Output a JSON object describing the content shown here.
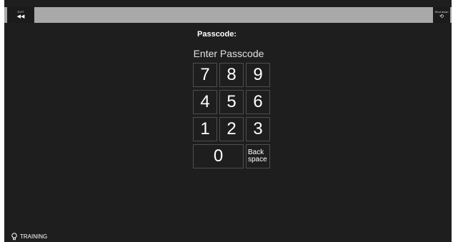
{
  "header": {
    "left_button": {
      "label": "EXIT",
      "icon": "back-arrow-icon"
    },
    "right_button": {
      "label": "Shut down",
      "icon": "power-icon"
    }
  },
  "passcode": {
    "title": "Passcode:",
    "prompt": "Enter Passcode"
  },
  "keypad": {
    "rows": [
      [
        "7",
        "8",
        "9"
      ],
      [
        "4",
        "5",
        "6"
      ],
      [
        "1",
        "2",
        "3"
      ]
    ],
    "zero": "0",
    "backspace_line1": "Back",
    "backspace_line2": "space"
  },
  "status": {
    "icon": "lightbulb-icon",
    "label": "TRAINING"
  },
  "colors": {
    "background": "#1e1e1e",
    "topbar": "#a9a9a9",
    "key_border": "#4e4e4e",
    "text": "#ffffff"
  }
}
